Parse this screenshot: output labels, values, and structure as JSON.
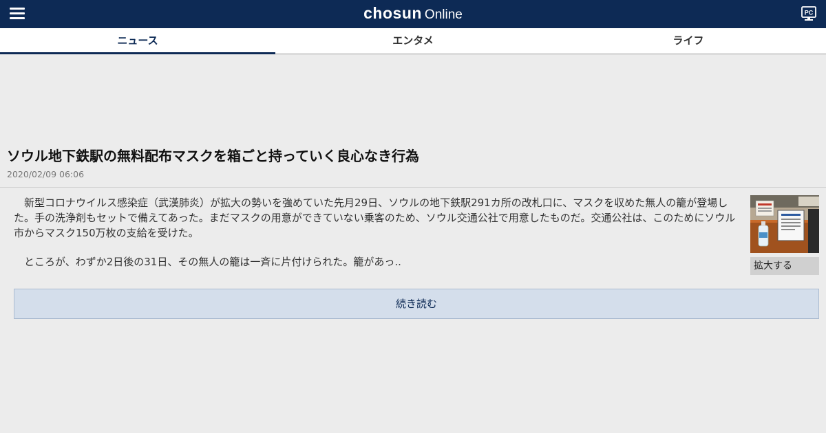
{
  "header": {
    "logo_brand": "chosun",
    "logo_suffix": "Online",
    "menu_icon": "hamburger-menu-icon",
    "pc_icon": "pc-monitor-icon",
    "pc_label": "PC",
    "bg_color": "#0d2a55"
  },
  "tabs": [
    {
      "label": "ニュース",
      "active": true
    },
    {
      "label": "エンタメ",
      "active": false
    },
    {
      "label": "ライフ",
      "active": false
    }
  ],
  "article": {
    "title": "ソウル地下鉄駅の無料配布マスクを箱ごと持っていく良心なき行為",
    "date": "2020/02/09 06:06",
    "paragraphs": [
      "新型コロナウイルス感染症（武漢肺炎）が拡大の勢いを強めていた先月29日、ソウルの地下鉄駅291カ所の改札口に、マスクを収めた無人の籠が登場した。手の洗浄剤もセットで備えてあった。まだマスクの用意ができていない乗客のため、ソウル交通公社で用意したものだ。交通公社は、このためにソウル市からマスク150万枚の支給を受けた。",
      "ところが、わずか2日後の31日、その無人の籠は一斉に片付けられた。籠があっ.."
    ],
    "photo_zoom_label": "拡大する",
    "read_more_label": "続き読む"
  }
}
